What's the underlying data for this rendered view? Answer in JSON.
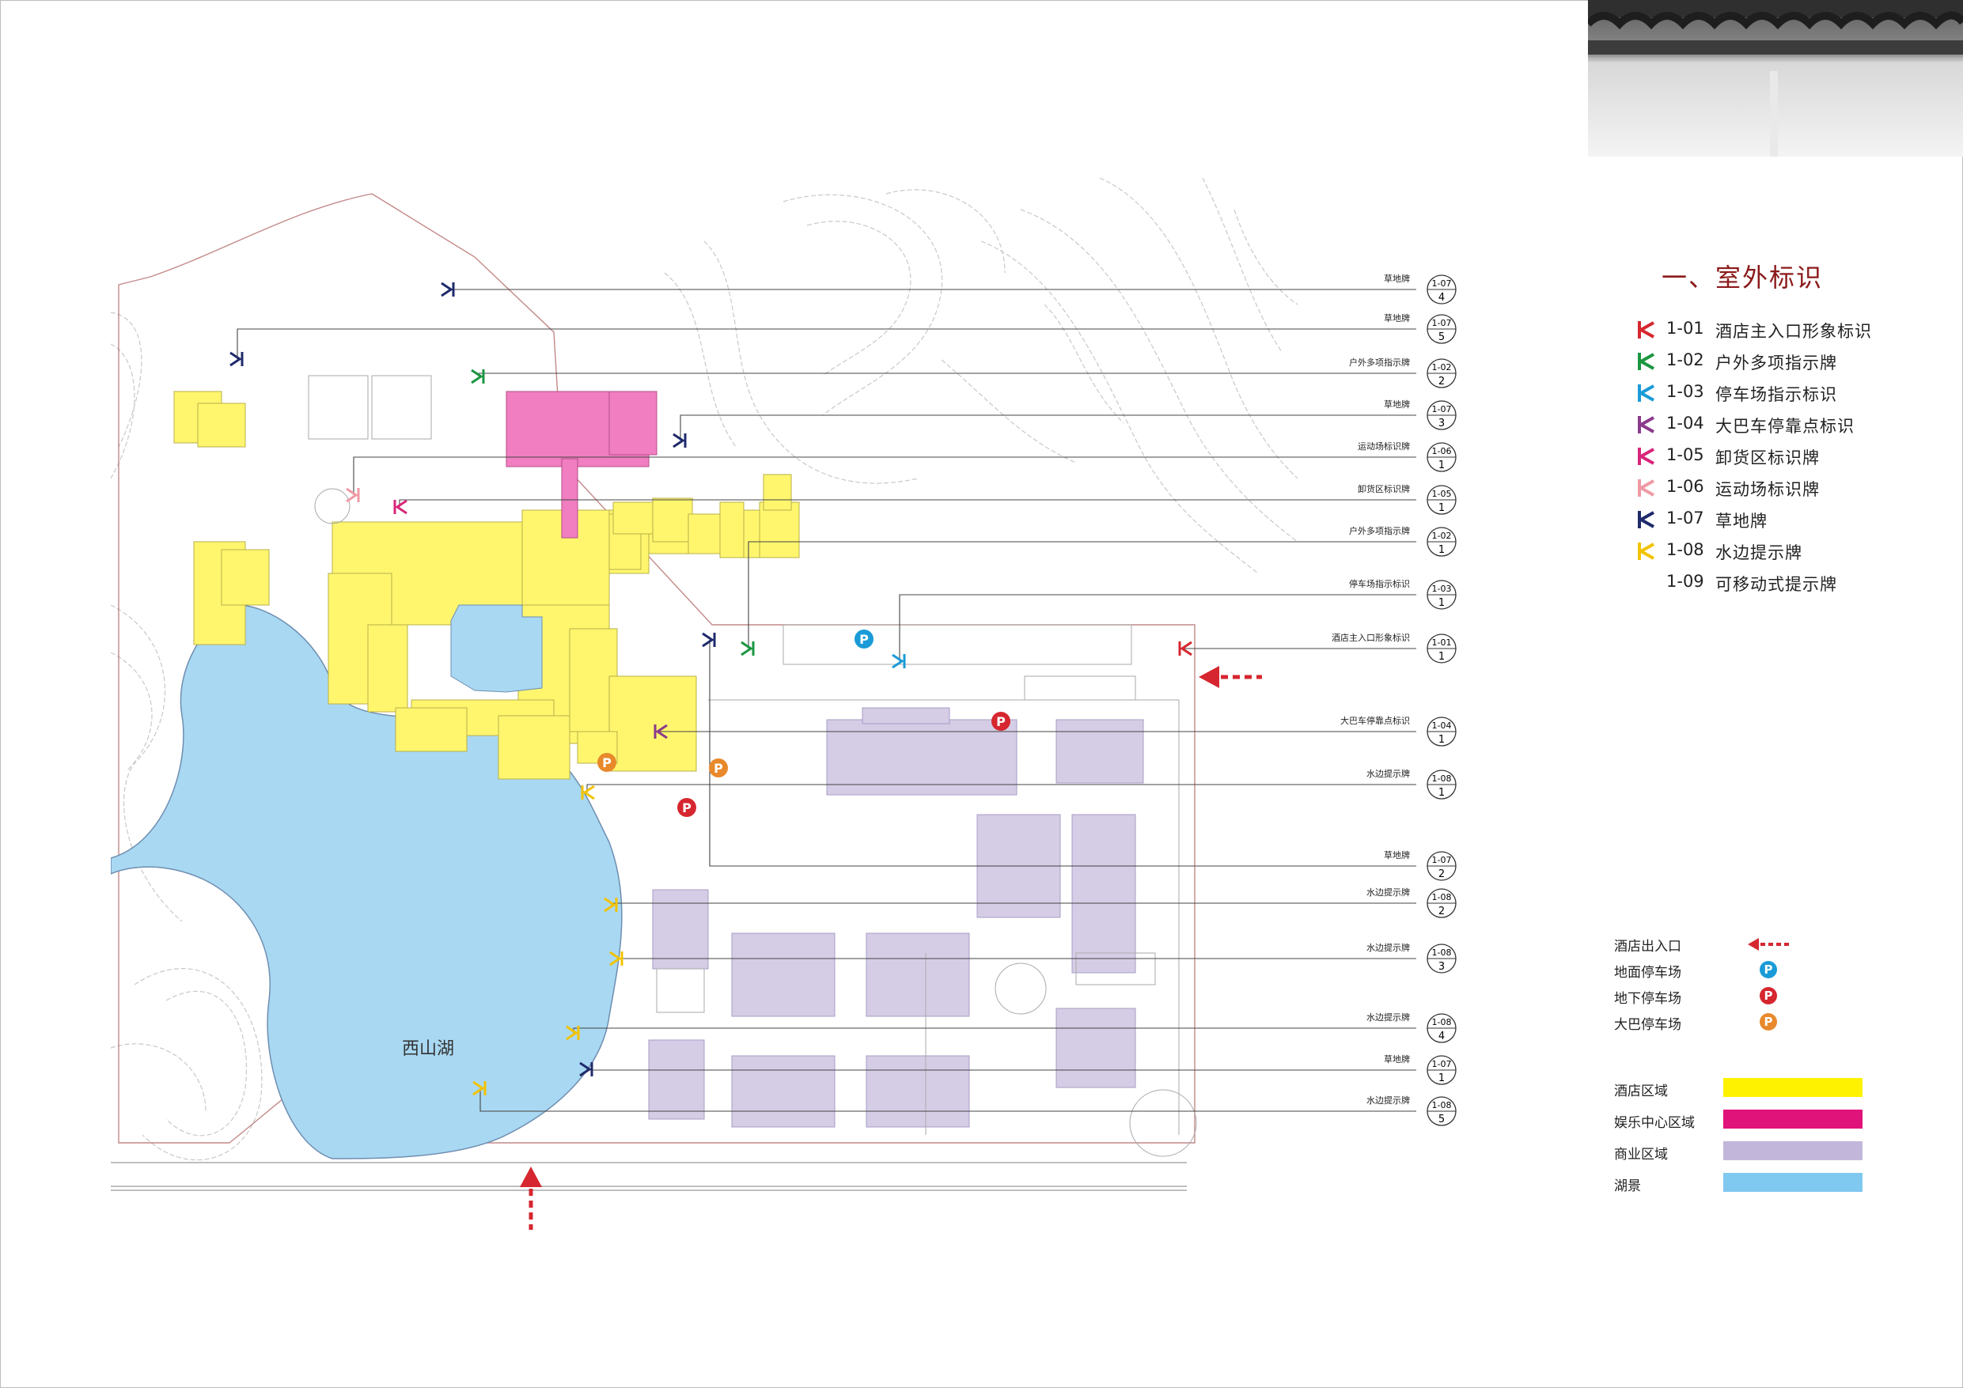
{
  "section_title": "一、室外标识",
  "sign_types": [
    {
      "code": "1-01",
      "name": "酒店主入口形象标识",
      "color": "#d6262f"
    },
    {
      "code": "1-02",
      "name": "户外多项指示牌",
      "color": "#1a9641"
    },
    {
      "code": "1-03",
      "name": "停车场指示标识",
      "color": "#1a9bd7"
    },
    {
      "code": "1-04",
      "name": "大巴车停靠点标识",
      "color": "#8b3a8b"
    },
    {
      "code": "1-05",
      "name": "卸货区标识牌",
      "color": "#d9267a"
    },
    {
      "code": "1-06",
      "name": "运动场标识牌",
      "color": "#ef9aa5"
    },
    {
      "code": "1-07",
      "name": "草地牌",
      "color": "#1f2a6b"
    },
    {
      "code": "1-08",
      "name": "水边提示牌",
      "color": "#f2c300"
    },
    {
      "code": "1-09",
      "name": "可移动式提示牌",
      "color": ""
    }
  ],
  "legend_facilities": [
    {
      "label": "酒店出入口",
      "icon": "dashed-red-arrow-icon",
      "color": "#d6262f"
    },
    {
      "label": "地面停车场",
      "icon": "P",
      "color": "#1a9bd7"
    },
    {
      "label": "地下停车场",
      "icon": "P",
      "color": "#d6262f"
    },
    {
      "label": "大巴停车场",
      "icon": "P",
      "color": "#e8892b"
    }
  ],
  "legend_areas": [
    {
      "label": "酒店区域",
      "color": "#fff200"
    },
    {
      "label": "娱乐中心区域",
      "color": "#e0137a"
    },
    {
      "label": "商业区域",
      "color": "#c2b7da"
    },
    {
      "label": "湖景",
      "color": "#7fc8ef"
    }
  ],
  "callouts": [
    {
      "label": "草地牌",
      "code": "1-07",
      "num": "4"
    },
    {
      "label": "草地牌",
      "code": "1-07",
      "num": "5"
    },
    {
      "label": "户外多项指示牌",
      "code": "1-02",
      "num": "2"
    },
    {
      "label": "草地牌",
      "code": "1-07",
      "num": "3"
    },
    {
      "label": "运动场标识牌",
      "code": "1-06",
      "num": "1"
    },
    {
      "label": "卸货区标识牌",
      "code": "1-05",
      "num": "1"
    },
    {
      "label": "户外多项指示牌",
      "code": "1-02",
      "num": "1"
    },
    {
      "label": "停车场指示标识",
      "code": "1-03",
      "num": "1"
    },
    {
      "label": "酒店主入口形象标识",
      "code": "1-01",
      "num": "1"
    },
    {
      "label": "大巴车停靠点标识",
      "code": "1-04",
      "num": "1"
    },
    {
      "label": "水边提示牌",
      "code": "1-08",
      "num": "1"
    },
    {
      "label": "草地牌",
      "code": "1-07",
      "num": "2"
    },
    {
      "label": "水边提示牌",
      "code": "1-08",
      "num": "2"
    },
    {
      "label": "水边提示牌",
      "code": "1-08",
      "num": "3"
    },
    {
      "label": "水边提示牌",
      "code": "1-08",
      "num": "4"
    },
    {
      "label": "草地牌",
      "code": "1-07",
      "num": "1"
    },
    {
      "label": "水边提示牌",
      "code": "1-08",
      "num": "5"
    }
  ],
  "map_labels": {
    "lake_name": "西山湖",
    "parking_letter": "P"
  }
}
